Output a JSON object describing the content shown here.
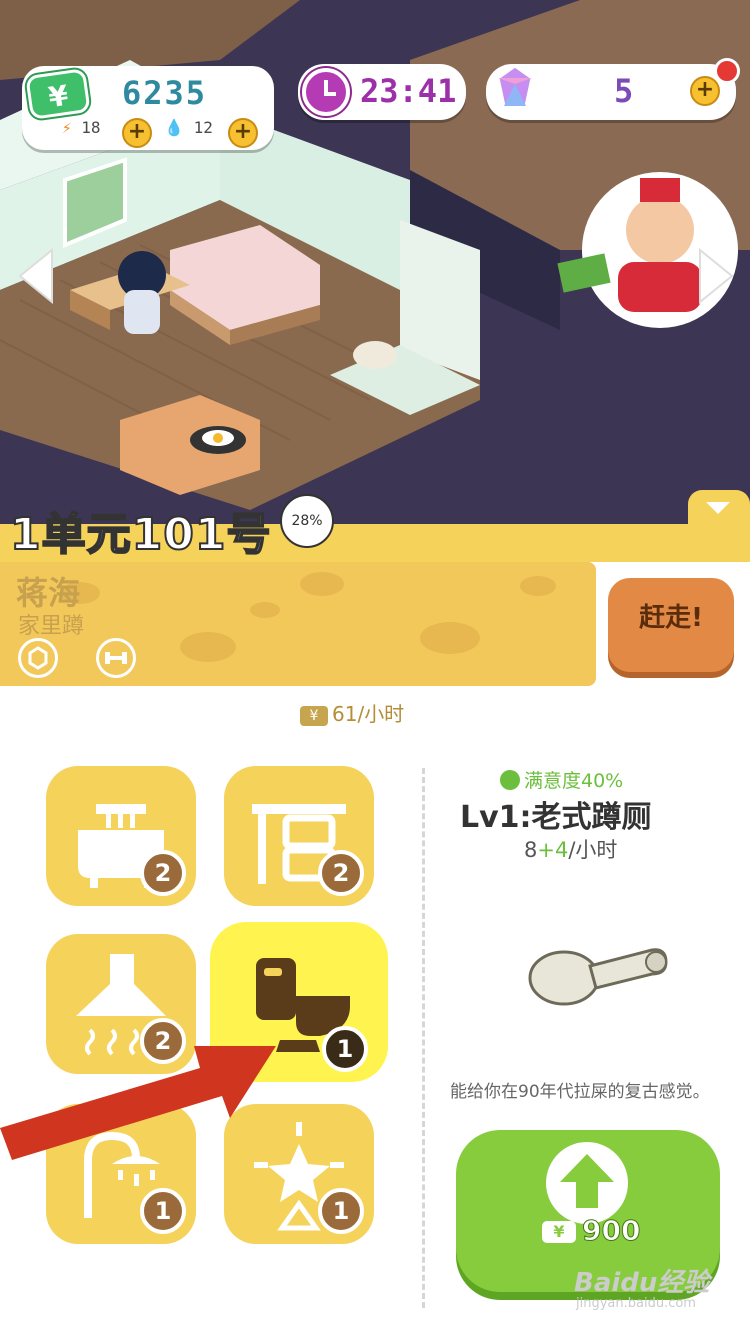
{
  "hud": {
    "money": "6235",
    "money_icon": "yen-icon",
    "energy": "18",
    "water": "12",
    "time": "23:41",
    "gems": "5",
    "colors": {
      "money": "#2f8aa0",
      "time": "#9b30a8",
      "gems": "#7b4bb6"
    }
  },
  "room": {
    "title": "1单元101号",
    "progress_percent": "28%"
  },
  "tenant": {
    "name": "蒋海",
    "status": "家里蹲",
    "evict_label": "赶走!",
    "rent": "61/小时"
  },
  "furniture_slots": [
    {
      "icon": "bathtub-icon",
      "count": "2"
    },
    {
      "icon": "desk-icon",
      "count": "2"
    },
    {
      "icon": "range-hood-icon",
      "count": "2"
    },
    {
      "icon": "toilet-icon",
      "count": "1",
      "selected": true
    },
    {
      "icon": "shower-icon",
      "count": "1"
    },
    {
      "icon": "star-light-icon",
      "count": "1"
    }
  ],
  "detail": {
    "satisfaction": "满意度40%",
    "title": "Lv1:老式蹲厕",
    "rate_base": "8",
    "rate_bonus": "+4",
    "rate_unit": "/小时",
    "description": "能给你在90年代拉屎的复古感觉。",
    "upgrade_cost": "900"
  },
  "watermark": {
    "brand": "Baidu经验",
    "url": "jingyan.baidu.com"
  }
}
